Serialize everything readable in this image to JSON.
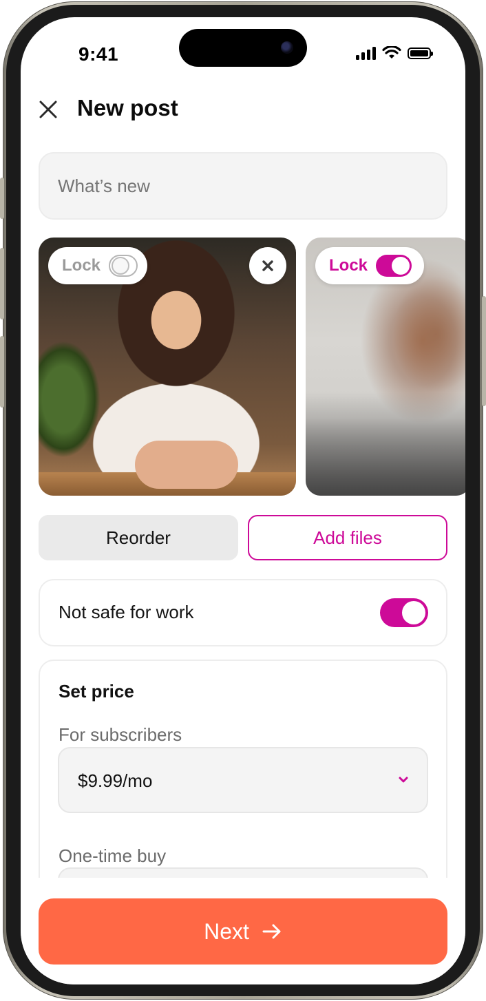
{
  "status_bar": {
    "time": "9:41"
  },
  "header": {
    "title": "New post"
  },
  "composer": {
    "placeholder": "What’s new"
  },
  "media": [
    {
      "lock_label": "Lock",
      "locked": false
    },
    {
      "lock_label": "Lock",
      "locked": true
    }
  ],
  "actions": {
    "reorder_label": "Reorder",
    "add_files_label": "Add files"
  },
  "nsfw": {
    "label": "Not safe for work",
    "enabled": true
  },
  "price": {
    "title": "Set price",
    "subscribers_label": "For subscribers",
    "subscribers_value": "$9.99/mo",
    "one_time_label": "One-time buy"
  },
  "footer": {
    "next_label": "Next"
  },
  "colors": {
    "accent": "#cd0a98",
    "cta": "#ff6845"
  },
  "icons": [
    "close-icon",
    "remove-icon",
    "chevron-down-icon",
    "arrow-right-icon",
    "signal-icon",
    "wifi-icon",
    "battery-icon"
  ]
}
